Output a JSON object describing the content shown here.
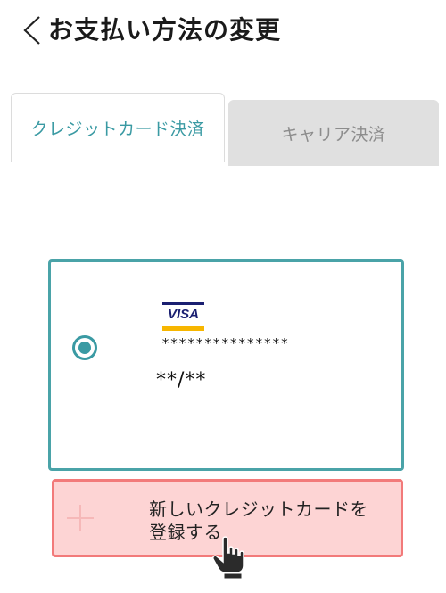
{
  "header": {
    "title": "お支払い方法の変更",
    "back_icon": "chevron-left-icon"
  },
  "tabs": [
    {
      "label": "クレジットカード決済",
      "active": true
    },
    {
      "label": "キャリア決済",
      "active": false
    }
  ],
  "card": {
    "brand": "VISA",
    "number_masked": "***************",
    "expiry_masked": "**/**",
    "selected": true
  },
  "add_card": {
    "label": "新しいクレジットカードを登録する",
    "icon": "plus-icon"
  },
  "colors": {
    "accent": "#3a9aa3",
    "add_button_bg": "#fdd4d4",
    "add_button_border": "#f27a7a",
    "inactive_tab_bg": "#e0e0e0"
  }
}
